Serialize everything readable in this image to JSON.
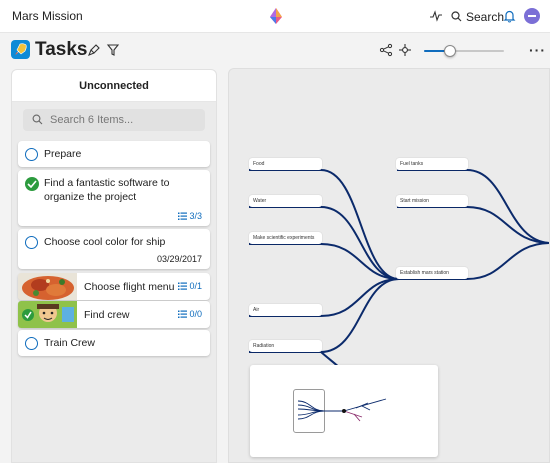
{
  "app": {
    "title": "Mars Mission",
    "search_label": "Search"
  },
  "page": {
    "title": "Tasks",
    "zoom_level": 0.32
  },
  "sidebar": {
    "header": "Unconnected",
    "search_placeholder": "Search 6 Items...",
    "items": [
      {
        "title": "Prepare",
        "status": "open"
      },
      {
        "title": "Find a fantastic software to organize the project",
        "status": "done",
        "subtasks": "3/3"
      },
      {
        "title": "Choose cool color for ship",
        "status": "open",
        "date": "03/29/2017"
      },
      {
        "title": "Choose flight menu",
        "status": "open",
        "subtasks": "0/1",
        "image": "food-photo"
      },
      {
        "title": "Find crew",
        "status": "open",
        "subtasks": "0/0",
        "image": "crew-photo"
      },
      {
        "title": "Train Crew",
        "status": "open"
      }
    ]
  },
  "map": {
    "left_nodes": [
      "Food",
      "Water",
      "Make scientific experiments",
      "Air",
      "Radiation"
    ],
    "center_node": "Establish mars station",
    "right_nodes": [
      "Fuel tanks",
      "Start mission"
    ]
  },
  "colors": {
    "accent": "#0f6cbd",
    "branch": "#0b2a6b",
    "done": "#2c9b3e"
  },
  "icons": {
    "app_logo": "diamond-logo-icon",
    "activity": "activity-icon",
    "search": "search-icon",
    "notifications": "bell-icon",
    "board": "rocket-icon",
    "settings": "brush-icon",
    "filter": "filter-icon",
    "connect": "share-nodes-icon",
    "center": "move-icon",
    "more": "more-icon",
    "subtasks": "list-icon"
  }
}
